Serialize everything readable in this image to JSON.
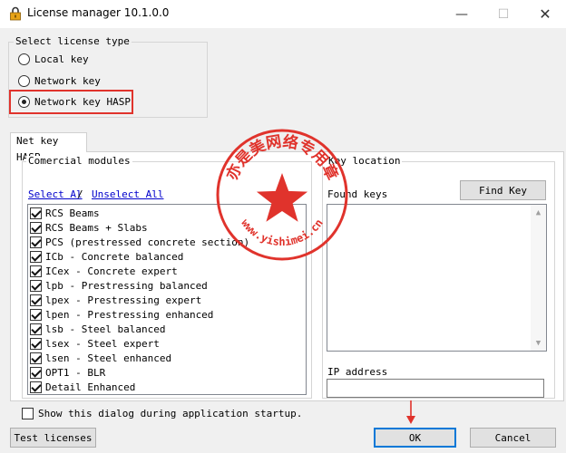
{
  "window": {
    "title": "License manager 10.1.0.0",
    "minimize": "—",
    "maximize": "☐",
    "close": "✕"
  },
  "license_type": {
    "label": "Select license type",
    "options": [
      {
        "label": "Local key",
        "selected": false
      },
      {
        "label": "Network key",
        "selected": false
      },
      {
        "label": "Network key HASP",
        "selected": true
      }
    ]
  },
  "tab": {
    "label": "Net key HASP"
  },
  "modules": {
    "label": "Comercial modules",
    "select_all": "Select Al",
    "separator": "/",
    "unselect_all": "Unselect All",
    "items": [
      {
        "label": "RCS Beams",
        "checked": true
      },
      {
        "label": "RCS Beams + Slabs",
        "checked": true
      },
      {
        "label": "PCS (prestressed concrete section)",
        "checked": true
      },
      {
        "label": "ICb - Concrete balanced",
        "checked": true
      },
      {
        "label": "ICex - Concrete expert",
        "checked": true
      },
      {
        "label": "lpb - Prestressing balanced",
        "checked": true
      },
      {
        "label": "lpex - Prestressing expert",
        "checked": true
      },
      {
        "label": "lpen - Prestressing enhanced",
        "checked": true
      },
      {
        "label": "lsb - Steel balanced",
        "checked": true
      },
      {
        "label": "lsex - Steel expert",
        "checked": true
      },
      {
        "label": "lsen - Steel enhanced",
        "checked": true
      },
      {
        "label": "OPT1 - BLR",
        "checked": true
      },
      {
        "label": "Detail Enhanced",
        "checked": true
      }
    ]
  },
  "key_location": {
    "label": "Key location",
    "found_keys": "Found keys",
    "find_key": "Find Key",
    "ip_label": "IP address",
    "ip_value": ""
  },
  "startup": {
    "label": "Show this dialog during application startup.",
    "checked": false
  },
  "buttons": {
    "test": "Test licenses",
    "ok": "OK",
    "cancel": "Cancel"
  },
  "watermark": {
    "text": "亦是美网络专用章",
    "url": "www.yishimei.cn",
    "color": "#e0332c"
  },
  "colors": {
    "accent": "#0078d7",
    "highlight": "#e0332c",
    "link": "#0000cc"
  }
}
